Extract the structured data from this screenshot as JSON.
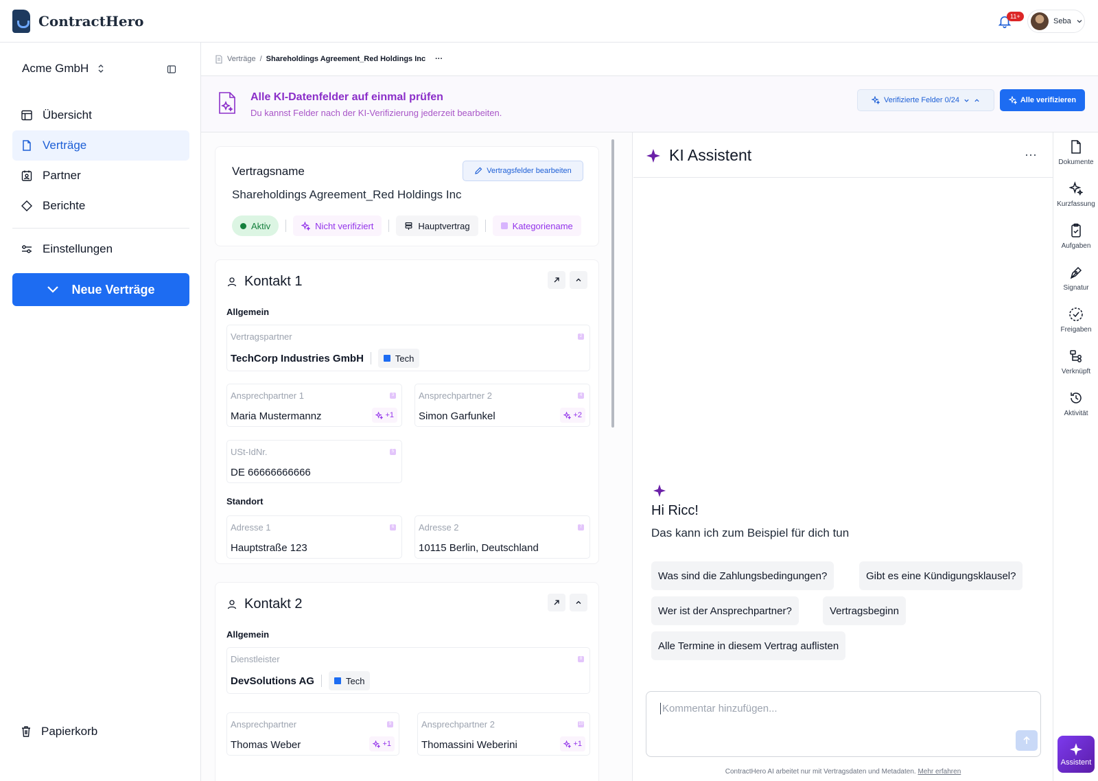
{
  "app": {
    "brand": "ContractHero",
    "notifications": "11+",
    "user": "Seba"
  },
  "sidebar": {
    "workspace": "Acme GmbH",
    "items": [
      {
        "label": "Übersicht",
        "icon": "layout-icon",
        "active": false
      },
      {
        "label": "Verträge",
        "icon": "document-icon",
        "active": true
      },
      {
        "label": "Partner",
        "icon": "contacts-icon",
        "active": false
      },
      {
        "label": "Berichte",
        "icon": "diamond-icon",
        "active": false
      }
    ],
    "settings": "Einstellungen",
    "new_button": "Neue Verträge",
    "trash": "Papierkorb"
  },
  "breadcrumb": {
    "parent": "Verträge",
    "current": "Shareholdings Agreement_Red Holdings Inc",
    "more": "···"
  },
  "banner": {
    "title": "Alle KI-Datenfelder auf einmal prüfen",
    "subtitle": "Du kannst Felder nach der KI-Verifizierung jederzeit bearbeiten.",
    "verified": "Verifizierte Felder 0/24",
    "verify_all": "Alle verifizieren"
  },
  "contract": {
    "label": "Vertragsname",
    "name": "Shareholdings Agreement_Red Holdings Inc",
    "edit": "Vertragsfelder bearbeiten",
    "tags": {
      "status": "Aktiv",
      "verification": "Nicht verifiziert",
      "type": "Hauptvertrag",
      "category": "Kategoriename"
    }
  },
  "contact1": {
    "title": "Kontakt 1",
    "section_general": "Allgemein",
    "partner_label": "Vertragspartner",
    "partner_num": "2",
    "partner": "TechCorp Industries GmbH",
    "partner_tag": "Tech",
    "ap1_label": "Ansprechpartner 1",
    "ap1_num": "3",
    "ap1": "Maria Mustermannz",
    "ap1_ai": "+1",
    "ap2_label": "Ansprechpartner 2",
    "ap2_num": "4",
    "ap2": "Simon Garfunkel",
    "ap2_ai": "+2",
    "ust_label": "USt-IdNr.",
    "ust_num": "5",
    "ust": "DE 66666666666",
    "section_location": "Standort",
    "addr1_label": "Adresse 1",
    "addr1_num": "6",
    "addr1": "Hauptstraße 123",
    "addr2_label": "Adresse 2",
    "addr2_num": "7",
    "addr2": "10115 Berlin, Deutschland"
  },
  "contact2": {
    "title": "Kontakt 2",
    "section_general": "Allgemein",
    "partner_label": "Dienstleister",
    "partner_num": "8",
    "partner": "DevSolutions AG",
    "partner_tag": "Tech",
    "ap1_label": "Ansprechpartner",
    "ap1_num": "9",
    "ap1": "Thomas Weber",
    "ap1_ai": "+1",
    "ap2_label": "Ansprechpartner 2",
    "ap2_num": "10",
    "ap2": "Thomassini Weberini",
    "ap2_ai": "+1"
  },
  "assistant": {
    "title": "KI Assistent",
    "greeting": "Hi Ricc!",
    "subtitle": "Das kann ich zum Beispiel für dich tun",
    "suggestions": [
      "Was sind die Zahlungsbedingungen?",
      "Gibt es eine Kündigungsklausel?",
      "Wer ist der Ansprechpartner?",
      "Vertragsbeginn",
      "Alle Termine in diesem Vertrag auflisten"
    ],
    "placeholder": "Kommentar hinzufügen...",
    "footnote": "ContractHero AI arbeitet nur mit Vertragsdaten und Metadaten.",
    "footnote_link": "Mehr erfahren"
  },
  "rail": [
    "Dokumente",
    "Kurzfassung",
    "Aufgaben",
    "Signatur",
    "Freigaben",
    "Verknüpft",
    "Aktivität"
  ],
  "rail_fab": "Assistent",
  "colors": {
    "primary": "#1d6cf2",
    "ai_purple": "#9333ea",
    "active_green": "#15803d",
    "notification_red": "#dc2626"
  }
}
